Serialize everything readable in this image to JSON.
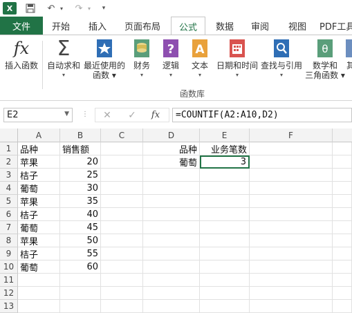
{
  "titlebar": {
    "app_icon_text": "X",
    "save_icon": "save-icon",
    "undo_icon": "undo-icon",
    "redo_icon": "redo-icon",
    "customize_icon": "customize-quick-access-icon"
  },
  "tabs": {
    "file": "文件",
    "items": [
      "开始",
      "插入",
      "页面布局",
      "公式",
      "数据",
      "审阅",
      "视图",
      "PDF工具"
    ],
    "active": "公式"
  },
  "ribbon": {
    "buttons": [
      {
        "label1": "插入函数",
        "label2": "",
        "icon": "insert-function-icon"
      },
      {
        "label1": "自动求和",
        "label2": "▾",
        "icon": "autosum-icon"
      },
      {
        "label1": "最近使用的",
        "label2": "函数 ▾",
        "icon": "recent-functions-icon"
      },
      {
        "label1": "财务",
        "label2": "▾",
        "icon": "financial-icon"
      },
      {
        "label1": "逻辑",
        "label2": "▾",
        "icon": "logical-icon"
      },
      {
        "label1": "文本",
        "label2": "▾",
        "icon": "text-icon"
      },
      {
        "label1": "日期和时间",
        "label2": "▾",
        "icon": "date-time-icon"
      },
      {
        "label1": "查找与引用",
        "label2": "▾",
        "icon": "lookup-reference-icon"
      },
      {
        "label1": "数学和",
        "label2": "三角函数 ▾",
        "icon": "math-trig-icon"
      },
      {
        "label1": "其",
        "label2": "",
        "icon": "more-functions-icon"
      }
    ],
    "group_label": "函数库"
  },
  "formula_bar": {
    "name_box": "E2",
    "cancel": "✕",
    "enter": "✓",
    "fx": "fx",
    "formula": "=COUNTIF(A2:A10,D2)"
  },
  "sheet": {
    "columns": [
      "A",
      "B",
      "C",
      "D",
      "E",
      "F"
    ],
    "rows": [
      "1",
      "2",
      "3",
      "4",
      "5",
      "6",
      "7",
      "8",
      "9",
      "10",
      "11",
      "12",
      "13"
    ],
    "A": [
      "品种",
      "苹果",
      "桔子",
      "葡萄",
      "苹果",
      "桔子",
      "葡萄",
      "苹果",
      "桔子",
      "葡萄"
    ],
    "B": [
      "销售额",
      "20",
      "25",
      "30",
      "35",
      "40",
      "45",
      "50",
      "55",
      "60"
    ],
    "D": [
      "品种",
      "葡萄"
    ],
    "E": [
      "业务笔数",
      "3"
    ]
  }
}
